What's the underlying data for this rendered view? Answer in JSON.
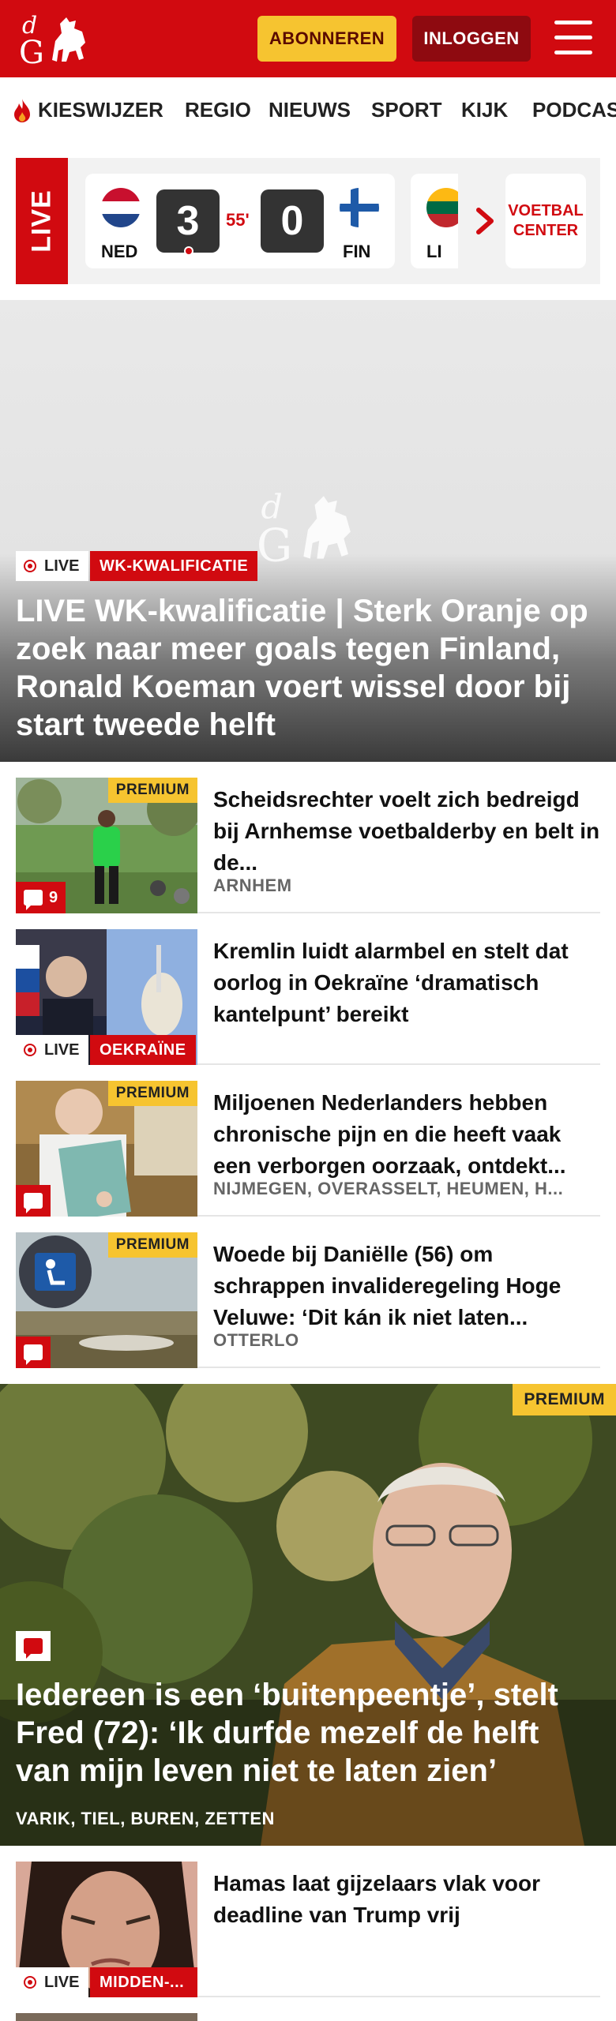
{
  "header": {
    "subscribe_label": "ABONNEREN",
    "login_label": "INLOGGEN",
    "brand_color": "#d10a10"
  },
  "nav": {
    "items": [
      "KIESWIJZER",
      "REGIO",
      "NIEUWS",
      "SPORT",
      "KIJK",
      "PODCAS"
    ]
  },
  "live_scores": {
    "live_label": "LIVE",
    "match": {
      "home_team": "NED",
      "home_score": "3",
      "minute": "55'",
      "away_score": "0",
      "away_team": "FIN"
    },
    "next_team_partial": "LI",
    "center_label_line1": "VOETBAL",
    "center_label_line2": "CENTER"
  },
  "hero": {
    "live_label": "LIVE",
    "category": "WK-KWALIFICATIE",
    "title": "LIVE WK-kwalificatie | Sterk Oranje op zoek naar meer goals tegen Finland, Ronald Koeman voert wissel door bij start tweede helft"
  },
  "articles": [
    {
      "premium": "PREMIUM",
      "comment_count": "9",
      "title": "Scheidsrechter voelt zich bedreigd bij Arnhemse voetbalderby en belt in de...",
      "location": "ARNHEM"
    },
    {
      "live_label": "LIVE",
      "category": "OEKRAÏNE",
      "title": "Kremlin luidt alarmbel en stelt dat oorlog in Oekraïne ‘dramatisch kantelpunt’ bereikt"
    },
    {
      "premium": "PREMIUM",
      "title": "Miljoenen Nederlanders hebben chronische pijn en die heeft vaak een verborgen oorzaak, ontdekt...",
      "location": "NIJMEGEN, OVERASSELT, HEUMEN, H..."
    },
    {
      "premium": "PREMIUM",
      "title": "Woede bij Daniëlle (56) om schrappen invalideregeling Hoge Veluwe: ‘Dit kán ik niet laten...",
      "location": "OTTERLO"
    }
  ],
  "feature": {
    "premium": "PREMIUM",
    "title": "Iedereen is een ‘buitenpeentje’, stelt Fred (72): ‘Ik durfde mezelf de helft van mijn leven niet te laten zien’",
    "location": "VARIK, TIEL, BUREN, ZETTEN"
  },
  "article_after": {
    "live_label": "LIVE",
    "category": "MIDDEN-...",
    "title": "Hamas laat gijzelaars vlak voor deadline van Trump vrij"
  }
}
